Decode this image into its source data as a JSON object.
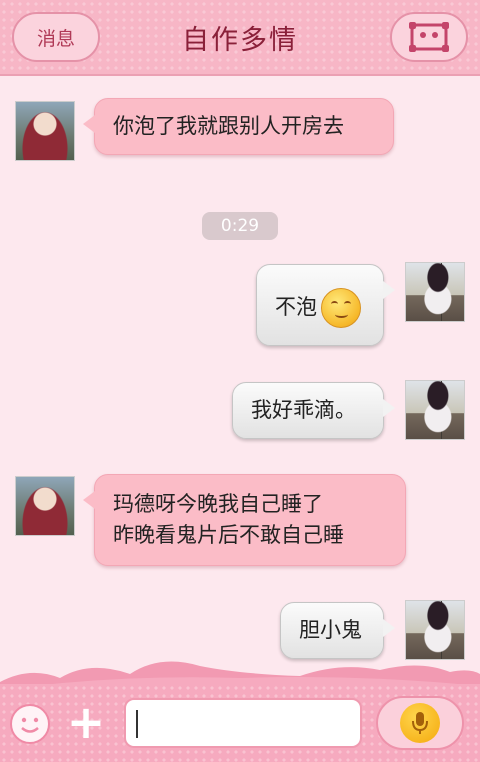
{
  "header": {
    "back_label": "消息",
    "title": "自作多情",
    "profile_icon": "profile-card-icon"
  },
  "messages": [
    {
      "side": "in",
      "text": "你泡了我就跟别人开房去"
    },
    {
      "type": "time",
      "text": "0:29"
    },
    {
      "side": "out",
      "text": "不泡",
      "emoji": "blush-smile-emoji"
    },
    {
      "side": "out",
      "text": "我好乖滴。"
    },
    {
      "side": "in",
      "lines": [
        "玛德呀今晚我自己睡了",
        "昨晚看鬼片后不敢自己睡"
      ]
    },
    {
      "side": "out",
      "text": "胆小鬼"
    }
  ],
  "input_bar": {
    "emoji_icon": "smiley-icon",
    "plus_icon": "plus-icon",
    "text_value": "",
    "voice_icon": "microphone-icon"
  },
  "colors": {
    "accent_pink": "#f7b6c6",
    "incoming_bubble": "#fbbcc7",
    "outgoing_bubble": "#efefef",
    "title_text": "#8a2039"
  }
}
